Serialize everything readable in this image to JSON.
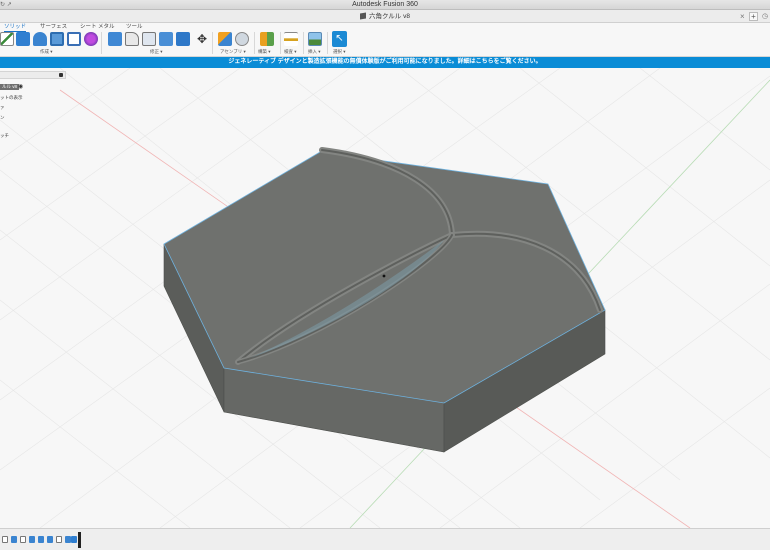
{
  "window": {
    "title": "Autodesk Fusion 360",
    "nav_symbol": "↻  ↗"
  },
  "document_tab": {
    "name": "六角クルル v8",
    "close_symbol": "×",
    "new_symbol": "+",
    "more_symbol": "◷"
  },
  "ribbon": {
    "tabs": [
      {
        "label": "ソリッド",
        "active": true
      },
      {
        "label": "サーフェス",
        "active": false
      },
      {
        "label": "シート メタル",
        "active": false
      },
      {
        "label": "ツール",
        "active": false
      }
    ],
    "groups": {
      "create": "作成 ▾",
      "modify": "修正 ▾",
      "assemble": "アセンブリ ▾",
      "construct": "構築 ▾",
      "inspect": "検査 ▾",
      "insert": "挿入 ▾",
      "select": "選択 ▾"
    }
  },
  "banner": {
    "text": "ジェネレーティブ デザインと製造拡張機能の無償体験版がご利用可能になりました。詳細はこちらをご覧ください。"
  },
  "browser": {
    "items": [
      "ルル v8",
      "ットの表示",
      "ァ",
      "ン",
      "ッチ"
    ],
    "radio_symbol": "◉"
  },
  "colors": {
    "accent": "#1a73c7",
    "banner": "#0a8cd6",
    "model_top": "#6f716e",
    "model_side": "#5b5d5a",
    "model_front": "#666865",
    "edge_highlight": "#6fb3e0"
  }
}
